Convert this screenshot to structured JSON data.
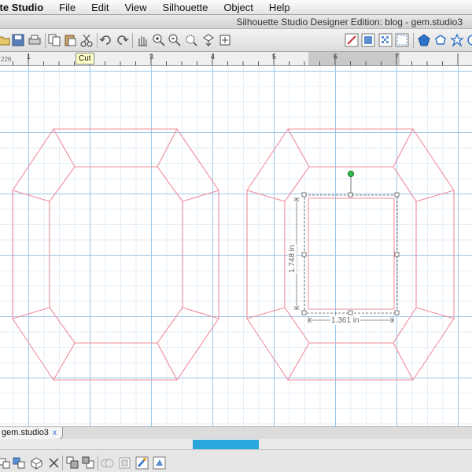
{
  "menubar": {
    "app": "ette Studio",
    "items": [
      "File",
      "Edit",
      "View",
      "Silhouette",
      "Object",
      "Help"
    ]
  },
  "window": {
    "title": "Silhouette Studio Designer Edition: blog - gem.studio3"
  },
  "toolbar": {
    "tooltip": "Cut",
    "left_icons": [
      "open-icon",
      "save-icon",
      "print-icon",
      "copy-icon",
      "paste-icon",
      "cut-icon",
      "undo-icon",
      "redo-icon",
      "pan-icon",
      "zoom-in-icon",
      "zoom-out-icon",
      "zoom-select-icon",
      "fit-to-page-icon",
      "zoom-page-icon"
    ],
    "right_icons": [
      "line-style-icon",
      "fill-color-icon",
      "fill-pattern-icon",
      "cut-settings-icon",
      "gem-shape-icon",
      "pentagon-shape-icon",
      "star-shape-icon",
      "flower-shape-icon"
    ]
  },
  "ruler": {
    "corner_value": "226",
    "labels": [
      "1",
      "2",
      "3",
      "4",
      "5",
      "6",
      "7"
    ]
  },
  "canvas": {
    "dimension_width": "1.361 in",
    "dimension_height": "1.748 in",
    "shape_color": "#f08c9a"
  },
  "tabs": {
    "document_name": "gem.studio3",
    "close": "x"
  },
  "bottom_toolbar": {
    "icons": [
      "group-icon",
      "ungroup-icon",
      "compound-icon",
      "release-compound-icon",
      "bring-front-icon",
      "send-back-icon",
      "weld-icon",
      "offset-icon",
      "trace-icon",
      "replicate-icon"
    ],
    "scroll_accent": "#29a6dc"
  }
}
